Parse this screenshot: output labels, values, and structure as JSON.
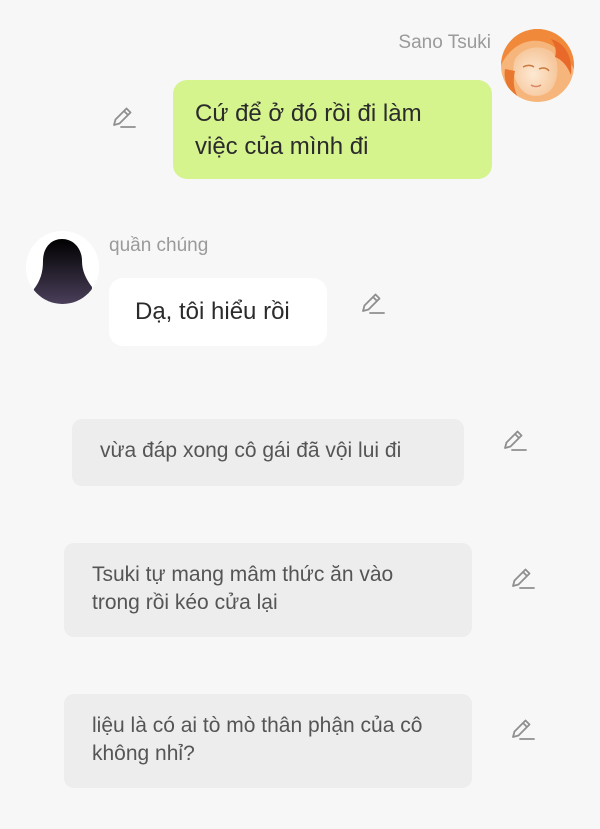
{
  "messages": [
    {
      "sender": "Sano Tsuki",
      "text": "Cứ để ở đó rồi đi làm việc của mình đi"
    },
    {
      "sender": "quần chúng",
      "text": "Dạ, tôi hiểu rồi"
    }
  ],
  "narrations": [
    {
      "text": "vừa đáp xong cô gái đã vội lui đi"
    },
    {
      "text": "Tsuki tự mang mâm thức ăn vào trong rồi kéo cửa lại"
    },
    {
      "text": "liệu là có ai tò mò thân phận của cô không nhỉ?"
    }
  ],
  "icons": {
    "edit": "pencil-edit-icon",
    "avatar_right": "anime-character-avatar",
    "avatar_left": "silhouette-avatar"
  },
  "colors": {
    "background": "#f7f7f7",
    "right_bubble": "#d5f48d",
    "left_bubble": "#ffffff",
    "narration_bubble": "#ededed"
  }
}
